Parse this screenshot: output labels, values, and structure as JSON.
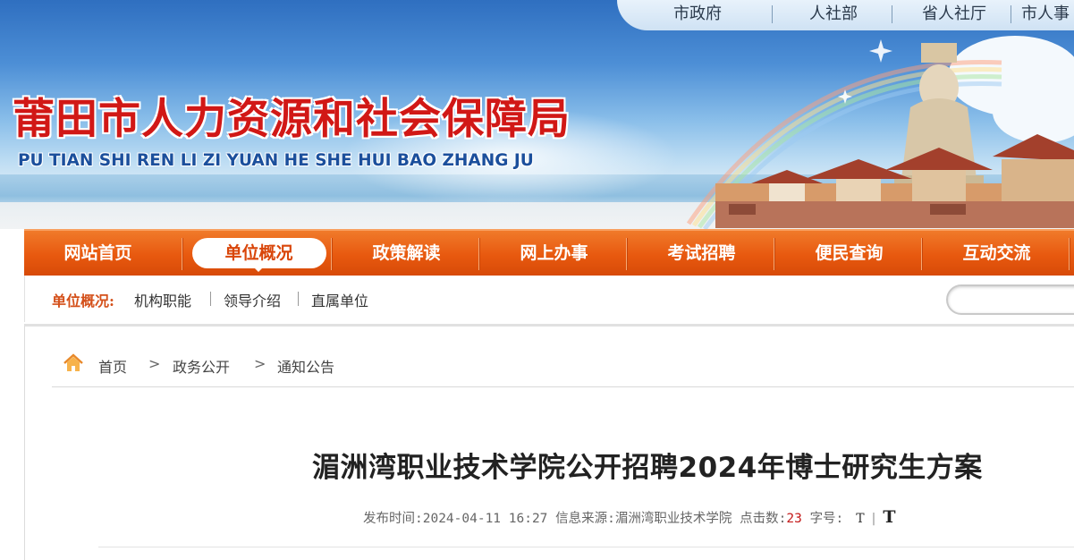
{
  "header": {
    "title": "莆田市人力资源和社会保障局",
    "pinyin": "PU TIAN SHI REN LI ZI YUAN HE SHE HUI BAO ZHANG JU",
    "title_color": "#d11816",
    "pinyin_color": "#1b4f9c",
    "top_links": [
      "市政府",
      "人社部",
      "省人社厅",
      "市人事"
    ]
  },
  "nav": {
    "accent": "#e8590f",
    "items": [
      "网站首页",
      "单位概况",
      "政策解读",
      "网上办事",
      "考试招聘",
      "便民查询",
      "互动交流"
    ],
    "active": "单位概况"
  },
  "subnav": {
    "label": "单位概况:",
    "links": [
      "机构职能",
      "领导介绍",
      "直属单位"
    ]
  },
  "breadcrumb": {
    "icon": "home-icon",
    "items": [
      "首页",
      "政务公开",
      "通知公告"
    ],
    "separator": ">"
  },
  "article": {
    "title": "湄洲湾职业技术学院公开招聘2024年博士研究生方案",
    "publish_label": "发布时间:",
    "publish_time": "2024-04-11 16:27",
    "source_label": "信息来源:",
    "source": "湄洲湾职业技术学院",
    "hits_label": "点击数:",
    "hits": "23",
    "font_label": "字号:",
    "font_small": "T",
    "font_divider": "|",
    "font_large": "T"
  }
}
